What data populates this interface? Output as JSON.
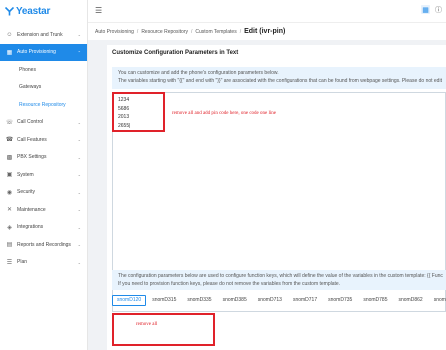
{
  "brand": {
    "name": "Yeastar"
  },
  "sidebar": {
    "items": [
      {
        "label": "Extension and Trunk",
        "icon": "users-icon",
        "has_chevron": true
      },
      {
        "label": "Auto Provisioning",
        "icon": "provision-icon",
        "has_chevron": true,
        "active": true
      },
      {
        "label": "Call Control",
        "icon": "phone-icon",
        "has_chevron": true
      },
      {
        "label": "Call Features",
        "icon": "call-features-icon",
        "has_chevron": true
      },
      {
        "label": "PBX Settings",
        "icon": "settings-grid-icon",
        "has_chevron": true
      },
      {
        "label": "System",
        "icon": "system-icon",
        "has_chevron": true
      },
      {
        "label": "Security",
        "icon": "shield-icon",
        "has_chevron": true
      },
      {
        "label": "Maintenance",
        "icon": "wrench-icon",
        "has_chevron": true
      },
      {
        "label": "Integrations",
        "icon": "integrations-icon",
        "has_chevron": true
      },
      {
        "label": "Reports and Recordings",
        "icon": "reports-icon",
        "has_chevron": true
      },
      {
        "label": "Plan",
        "icon": "plan-icon",
        "has_chevron": true
      }
    ],
    "sub_items": [
      {
        "label": "Phones"
      },
      {
        "label": "Gateways"
      },
      {
        "label": "Resource Repository",
        "selected": true
      }
    ]
  },
  "breadcrumb": {
    "items": [
      "Auto Provisioning",
      "Resource Repository",
      "Custom Templates"
    ],
    "current": "Edit (ivr-pin)"
  },
  "main": {
    "section_title": "Customize Configuration Parameters in Text",
    "info_line1": "You can customize and add the phone's configuration parameters below.",
    "info_line2": "The variables starting with \"{{\" and end with \"}}\" are associated with the configurations that can be found from webpage settings. Please do not edit",
    "editor_lines": [
      "1234",
      "5686",
      "2013",
      "2655|"
    ],
    "info2_line1": "The configuration parameters below are used to configure function keys, which will define the value of the variables in the custom template: {{ Func",
    "info2_line2": "If you need to provision function keys, please do not remove the variables from the custom template.",
    "tabs": [
      "snomD120",
      "snomD315",
      "snomD335",
      "snomD385",
      "snomD713",
      "snomD717",
      "snomD735",
      "snomD785",
      "snomD862",
      "snom"
    ],
    "active_tab": 0
  },
  "annotations": {
    "editor_note": "remove all and add pin code here, one code one line",
    "bottom_note": "remove all",
    "color": "#e0222a"
  }
}
